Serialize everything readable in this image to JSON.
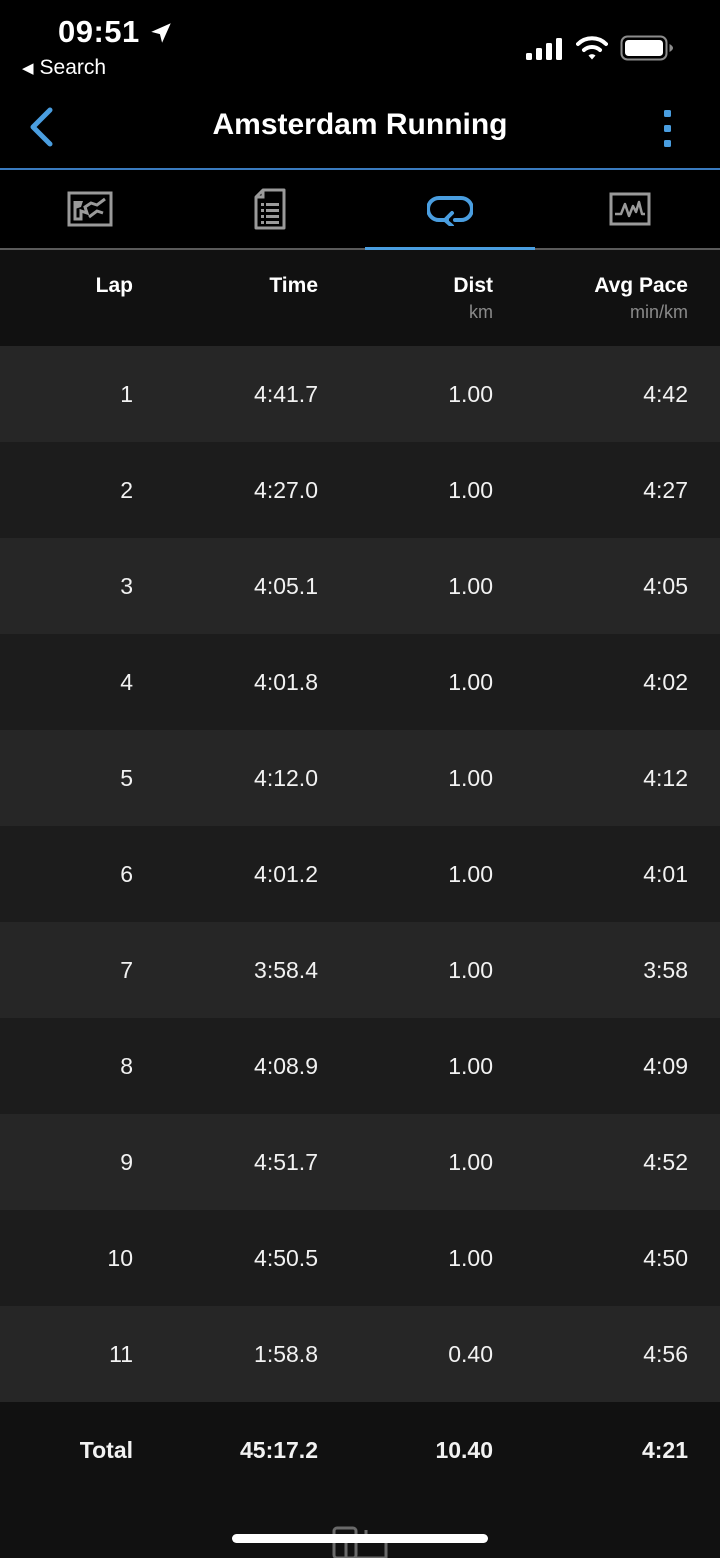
{
  "status_bar": {
    "time": "09:51",
    "back_app": "Search",
    "icons": [
      "location-arrow-icon",
      "cellular-signal-icon",
      "wifi-icon",
      "battery-icon"
    ]
  },
  "nav": {
    "title": "Amsterdam Running",
    "back_icon": "chevron-left-icon",
    "more_icon": "more-vertical-icon"
  },
  "tabs": [
    {
      "icon": "map-icon",
      "active": false
    },
    {
      "icon": "details-list-icon",
      "active": false
    },
    {
      "icon": "laps-loop-icon",
      "active": true
    },
    {
      "icon": "chart-icon",
      "active": false
    }
  ],
  "table": {
    "headers": {
      "lap": "Lap",
      "time": "Time",
      "dist": "Dist",
      "dist_unit": "km",
      "pace": "Avg Pace",
      "pace_unit": "min/km"
    },
    "rows": [
      {
        "lap": "1",
        "time": "4:41.7",
        "dist": "1.00",
        "pace": "4:42"
      },
      {
        "lap": "2",
        "time": "4:27.0",
        "dist": "1.00",
        "pace": "4:27"
      },
      {
        "lap": "3",
        "time": "4:05.1",
        "dist": "1.00",
        "pace": "4:05"
      },
      {
        "lap": "4",
        "time": "4:01.8",
        "dist": "1.00",
        "pace": "4:02"
      },
      {
        "lap": "5",
        "time": "4:12.0",
        "dist": "1.00",
        "pace": "4:12"
      },
      {
        "lap": "6",
        "time": "4:01.2",
        "dist": "1.00",
        "pace": "4:01"
      },
      {
        "lap": "7",
        "time": "3:58.4",
        "dist": "1.00",
        "pace": "3:58"
      },
      {
        "lap": "8",
        "time": "4:08.9",
        "dist": "1.00",
        "pace": "4:09"
      },
      {
        "lap": "9",
        "time": "4:51.7",
        "dist": "1.00",
        "pace": "4:52"
      },
      {
        "lap": "10",
        "time": "4:50.5",
        "dist": "1.00",
        "pace": "4:50"
      },
      {
        "lap": "11",
        "time": "1:58.8",
        "dist": "0.40",
        "pace": "4:56"
      }
    ],
    "total": {
      "label": "Total",
      "time": "45:17.2",
      "dist": "10.40",
      "pace": "4:21"
    }
  },
  "colors": {
    "accent": "#4a9ee0",
    "background": "#000000",
    "row_odd": "#262626",
    "row_even": "#1c1c1c",
    "header_bg": "#111111"
  }
}
